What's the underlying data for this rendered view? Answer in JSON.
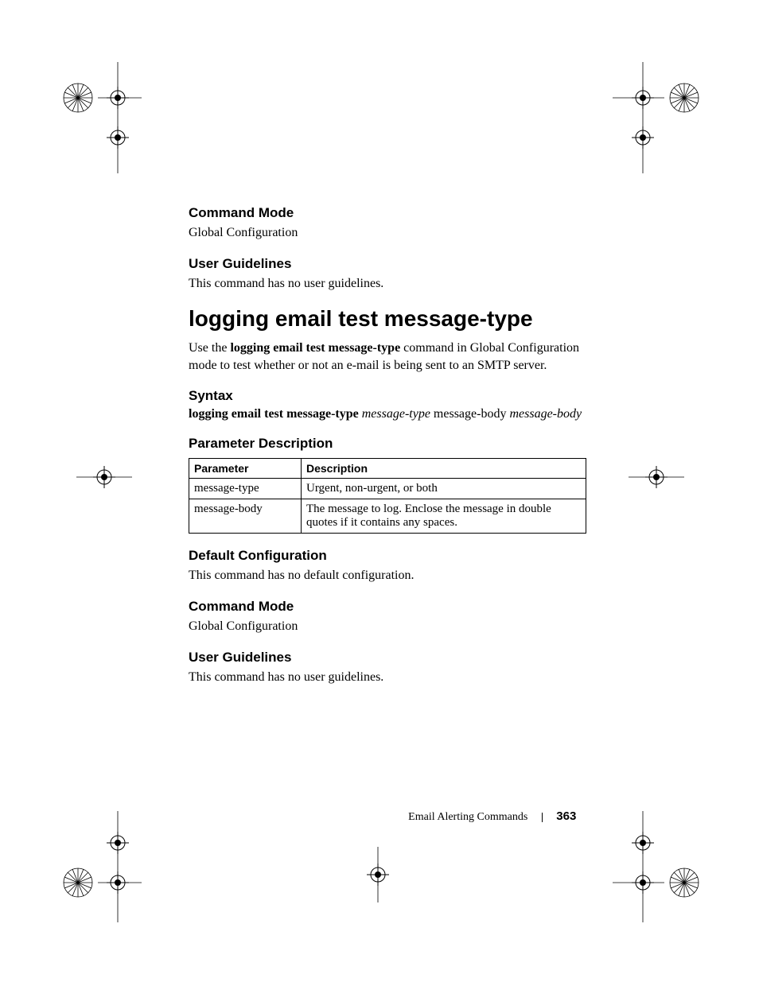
{
  "sections": {
    "cmd_mode_1": {
      "heading": "Command Mode",
      "text": "Global Configuration"
    },
    "guidelines_1": {
      "heading": "User Guidelines",
      "text": "This command has no user guidelines."
    },
    "main_heading": "logging email test message-type",
    "intro": {
      "pre": "Use the ",
      "bold": "logging email test message-type",
      "post": " command in Global Configuration mode to test whether or not an e-mail is being sent to an SMTP server."
    },
    "syntax": {
      "heading": "Syntax",
      "cmd_bold": "logging email test message-type",
      "arg1_italic": "message-type",
      "mid": " message-body ",
      "arg2_italic": "message-body"
    },
    "param_desc_heading": "Parameter Description",
    "table": {
      "headers": {
        "p": "Parameter",
        "d": "Description"
      },
      "rows": [
        {
          "p": "message-type",
          "d": "Urgent, non-urgent, or both"
        },
        {
          "p": "message-body",
          "d": "The message to log. Enclose the message in double quotes if it contains any spaces."
        }
      ]
    },
    "default_cfg": {
      "heading": "Default Configuration",
      "text": "This command has no default configuration."
    },
    "cmd_mode_2": {
      "heading": "Command Mode",
      "text": "Global Configuration"
    },
    "guidelines_2": {
      "heading": "User Guidelines",
      "text": "This command has no user guidelines."
    }
  },
  "footer": {
    "chapter": "Email Alerting Commands",
    "page": "363"
  }
}
